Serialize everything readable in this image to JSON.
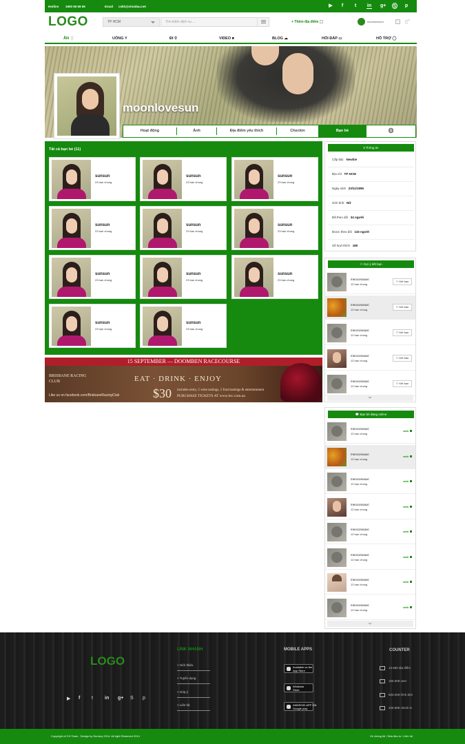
{
  "topbar": {
    "hotline_label": "Hotline",
    "hotline": "1900 59 59 59",
    "email_label": "Email",
    "email": "cskh@choidau.net",
    "social_icons": [
      "play-icon",
      "facebook-icon",
      "twitter-icon",
      "linkedin-icon",
      "google-plus-icon",
      "skype-icon",
      "pinterest-icon"
    ]
  },
  "header": {
    "logo": "LOGO",
    "city": "TP HCM",
    "search_placeholder": "Tìm kiếm dịch vụ ...",
    "add_place": "+ Thêm địa điểm",
    "username": "moonlovesun",
    "notifications": "14"
  },
  "nav": [
    "ĂN",
    "UỐNG",
    "ĐI",
    "VIDEO",
    "BLOG",
    "HỎI ĐÁP",
    "HỖ TRỢ"
  ],
  "profile": {
    "name": "moonlovesun",
    "tabs": [
      "Hoạt động",
      "Ảnh",
      "Địa điểm yêu thích",
      "Checkin",
      "Bạn bè"
    ],
    "active_tab": "Bạn bè"
  },
  "friends": {
    "title": "Tất cả bạn bè (11)",
    "items": [
      {
        "name": "sunsun",
        "mutual": "23 bạn chung"
      },
      {
        "name": "sunsun",
        "mutual": "23 bạn chung"
      },
      {
        "name": "sunsun",
        "mutual": "23 bạn chung"
      },
      {
        "name": "sunsun",
        "mutual": "23 bạn chung"
      },
      {
        "name": "sunsun",
        "mutual": "23 bạn chung"
      },
      {
        "name": "sunsun",
        "mutual": "23 bạn chung"
      },
      {
        "name": "sunsun",
        "mutual": "23 bạn chung"
      },
      {
        "name": "sunsun",
        "mutual": "23 bạn chung"
      },
      {
        "name": "sunsun",
        "mutual": "23 bạn chung"
      },
      {
        "name": "sunsun",
        "mutual": "23 bạn chung"
      },
      {
        "name": "sunsun",
        "mutual": "23 bạn chung"
      }
    ]
  },
  "banner": {
    "top": "15 SEPTEMBER — DOOMBEN RACECOURSE",
    "club": "BRISBANE RACING CLUB",
    "eat": "EAT · DRINK · ENJOY",
    "price": "$30",
    "includes": "includes entry, 5 wine tastings, 5 food tastings & entertainment",
    "buy": "PURCHASE TICKETS AT www.brc.com.au",
    "like": "Like us on  facebook.com/BrisbaneRacingClub"
  },
  "info": {
    "title": "Thông tin",
    "rows": [
      {
        "label": "Cấp bậc",
        "value": "Newbie"
      },
      {
        "label": "Địa chỉ",
        "value": "TP HCM"
      },
      {
        "label": "Ngày sinh",
        "value": "23/11/1995"
      },
      {
        "label": "Giới tính",
        "value": "Nữ"
      },
      {
        "label": "Đã theo dõi",
        "value": "34 người"
      },
      {
        "label": "Được theo dõi",
        "value": "115 người"
      },
      {
        "label": "Số lượt thích",
        "value": "180"
      }
    ]
  },
  "suggest": {
    "title": "Gợi ý kết bạn",
    "button": "Kết bạn",
    "items": [
      {
        "name": "meoconxauxi",
        "mutual": "12 bạn chung",
        "avatar": "cat"
      },
      {
        "name": "meoconxauxi",
        "mutual": "12 bạn chung",
        "avatar": "fruit"
      },
      {
        "name": "meoconxauxi",
        "mutual": "12 bạn chung",
        "avatar": "cat"
      },
      {
        "name": "meoconxauxi",
        "mutual": "12 bạn chung",
        "avatar": "girl"
      },
      {
        "name": "meoconxauxi",
        "mutual": "12 bạn chung",
        "avatar": "cat"
      }
    ]
  },
  "online": {
    "title": "Bạn bè đang online",
    "status": "web",
    "items": [
      {
        "name": "meoconxauxi",
        "mutual": "12 bạn chung",
        "avatar": "cat"
      },
      {
        "name": "meoconxauxi",
        "mutual": "12 bạn chung",
        "avatar": "fruit"
      },
      {
        "name": "meoconxauxi",
        "mutual": "12 bạn chung",
        "avatar": "cat"
      },
      {
        "name": "meoconxauxi",
        "mutual": "12 bạn chung",
        "avatar": "girl"
      },
      {
        "name": "meoconxauxi",
        "mutual": "12 bạn chung",
        "avatar": "cat"
      },
      {
        "name": "meoconxauxi",
        "mutual": "12 bạn chung",
        "avatar": "cat"
      },
      {
        "name": "meoconxauxi",
        "mutual": "12 bạn chung",
        "avatar": "boy"
      },
      {
        "name": "meoconxauxi",
        "mutual": "12 bạn chung",
        "avatar": "cat"
      }
    ]
  },
  "footer": {
    "logo": "LOGO",
    "links_title": "LINK NHANH",
    "links": [
      "Giới thiệu",
      "Tuyển dụng",
      "Góp ý",
      "Liên hệ"
    ],
    "apps_title": "MOBILE APPS",
    "apps": [
      {
        "line1": "Available on the",
        "line2": "App Store"
      },
      {
        "line1": "Windows",
        "line2": "Store"
      },
      {
        "line1": "ANDROID APP ON",
        "line2": "Google play"
      }
    ],
    "counter_title": "COUNTER",
    "counters": [
      "13.580 địa điểm",
      "156.908 user",
      "500.009 hình ảnh",
      "345.888 check in"
    ],
    "copyright": "Copyright of CH Team . Design by Suntory 2014. All right Reserved 2014",
    "bottom_links": "Về chúng tôi / Nhà đầu tư / Liên hệ"
  },
  "colors": {
    "brand_green": "#158a0f",
    "footer_bg": "#1f1f1f"
  }
}
